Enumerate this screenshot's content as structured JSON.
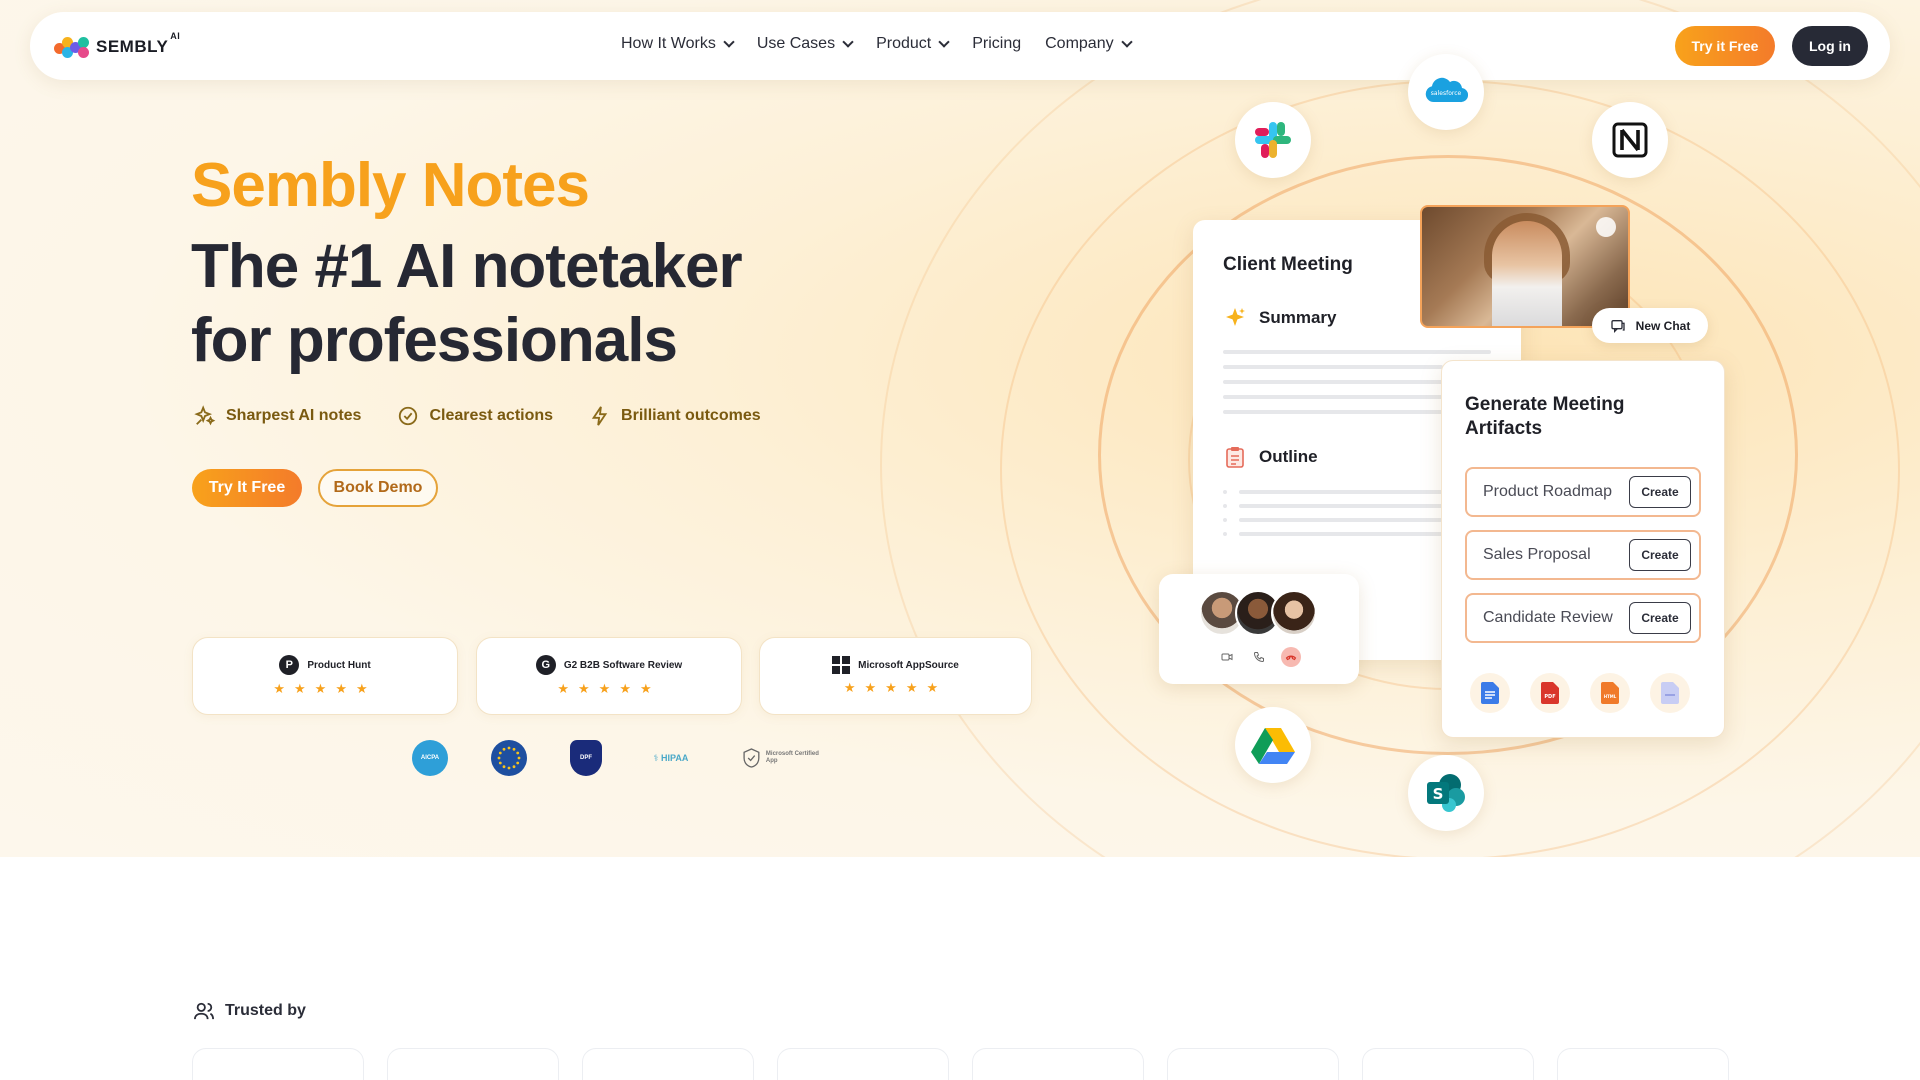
{
  "nav": {
    "brand": "SEMBLY",
    "brand_sup": "AI",
    "links": [
      {
        "label": "How It Works",
        "dropdown": true
      },
      {
        "label": "Use Cases",
        "dropdown": true
      },
      {
        "label": "Product",
        "dropdown": true
      },
      {
        "label": "Pricing",
        "dropdown": false
      },
      {
        "label": "Company",
        "dropdown": true
      }
    ],
    "try_free": "Try it Free",
    "login": "Log in"
  },
  "hero": {
    "brand_title": "Sembly Notes",
    "title_line1": "The #1 AI notetaker",
    "title_line2": "for professionals",
    "features": [
      "Sharpest AI notes",
      "Clearest actions",
      "Brilliant outcomes"
    ],
    "try_free": "Try It Free",
    "book_demo": "Book Demo"
  },
  "reviews": [
    {
      "name": "Product Hunt",
      "stars": "★★★★★"
    },
    {
      "name": "G2 B2B Software Review",
      "stars": "★★★★★"
    },
    {
      "name": "Microsoft AppSource",
      "stars": "★★★★★"
    }
  ],
  "compliance_badges": [
    "AICPA SOC",
    "GDPR",
    "EU-US DPF",
    "HIPAA",
    "Microsoft Certified App"
  ],
  "mock": {
    "card_title": "Client Meeting",
    "summary": "Summary",
    "outline": "Outline",
    "new_chat": "New Chat",
    "generate_title": "Generate Meeting Artifacts",
    "artifacts": [
      {
        "label": "Product Roadmap",
        "action": "Create"
      },
      {
        "label": "Sales Proposal",
        "action": "Create"
      },
      {
        "label": "Candidate Review",
        "action": "Create"
      }
    ],
    "file_types": [
      "docs",
      "pdf",
      "html",
      "notes"
    ],
    "integrations": [
      "slack",
      "salesforce",
      "notion",
      "google-drive",
      "sharepoint"
    ],
    "salesforce_label": "salesforce"
  },
  "trusted": {
    "label": "Trusted by"
  },
  "colors": {
    "accent_orange": "#f7a11c",
    "dark": "#272a36"
  }
}
